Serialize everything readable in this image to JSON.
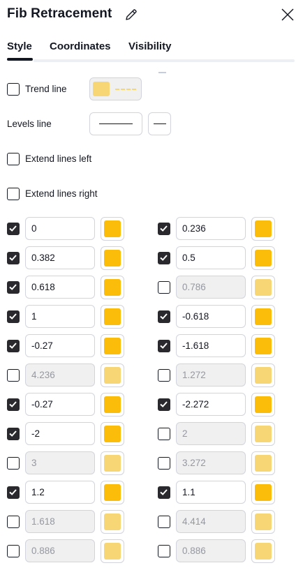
{
  "dialog": {
    "title": "Fib Retracement"
  },
  "tabs": [
    {
      "label": "Style",
      "active": true
    },
    {
      "label": "Coordinates",
      "active": false
    },
    {
      "label": "Visibility",
      "active": false
    }
  ],
  "colors": {
    "level_color": "#fbbd0a",
    "level_color_disabled": "#f7d675",
    "trend_color": "#f7d675"
  },
  "style": {
    "trend_line": {
      "label": "Trend line",
      "checked": false
    },
    "levels_line": {
      "label": "Levels line"
    },
    "extend_left": {
      "label": "Extend lines left",
      "checked": false
    },
    "extend_right": {
      "label": "Extend lines right",
      "checked": false
    }
  },
  "levels": [
    {
      "value": "0",
      "checked": true
    },
    {
      "value": "0.236",
      "checked": true
    },
    {
      "value": "0.382",
      "checked": true
    },
    {
      "value": "0.5",
      "checked": true
    },
    {
      "value": "0.618",
      "checked": true
    },
    {
      "value": "0.786",
      "checked": false
    },
    {
      "value": "1",
      "checked": true
    },
    {
      "value": "-0.618",
      "checked": true
    },
    {
      "value": "-0.27",
      "checked": true
    },
    {
      "value": "-1.618",
      "checked": true
    },
    {
      "value": "4.236",
      "checked": false
    },
    {
      "value": "1.272",
      "checked": false
    },
    {
      "value": "-0.27",
      "checked": true
    },
    {
      "value": "-2.272",
      "checked": true
    },
    {
      "value": "-2",
      "checked": true
    },
    {
      "value": "2",
      "checked": false
    },
    {
      "value": "3",
      "checked": false
    },
    {
      "value": "3.272",
      "checked": false
    },
    {
      "value": "1.2",
      "checked": true
    },
    {
      "value": "1.1",
      "checked": true
    },
    {
      "value": "1.618",
      "checked": false
    },
    {
      "value": "4.414",
      "checked": false
    },
    {
      "value": "0.886",
      "checked": false
    },
    {
      "value": "0.886",
      "checked": false
    }
  ]
}
